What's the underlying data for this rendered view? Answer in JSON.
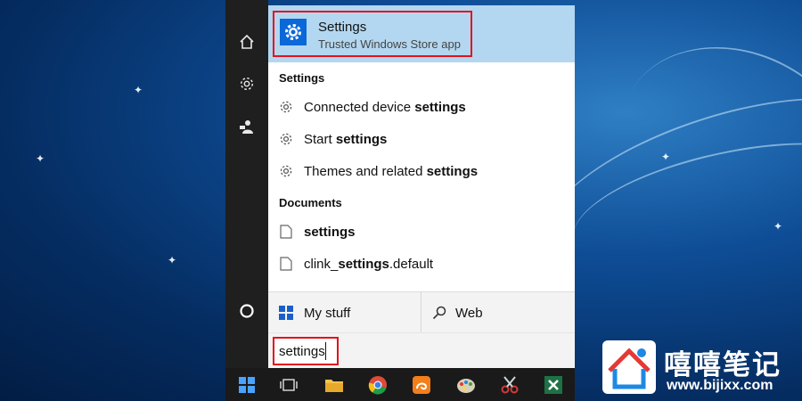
{
  "best_match": {
    "title": "Settings",
    "subtitle": "Trusted Windows Store app"
  },
  "sections": {
    "settings_header": "Settings",
    "documents_header": "Documents"
  },
  "settings_results": [
    {
      "prefix": "Connected device ",
      "match": "settings",
      "suffix": "",
      "icon": "gear-icon"
    },
    {
      "prefix": "Start ",
      "match": "settings",
      "suffix": "",
      "icon": "gear-icon"
    },
    {
      "prefix": "Themes and related ",
      "match": "settings",
      "suffix": "",
      "icon": "gear-icon"
    }
  ],
  "document_results": [
    {
      "prefix": "",
      "match": "settings",
      "suffix": "",
      "icon": "document-icon"
    },
    {
      "prefix": "clink_",
      "match": "settings",
      "suffix": ".default",
      "icon": "document-icon"
    }
  ],
  "bottom": {
    "my_stuff": "My stuff",
    "web": "Web"
  },
  "search": {
    "query": "settings"
  },
  "watermark": {
    "brand": "嘻嘻笔记",
    "url": "www.bijixx.com"
  },
  "colors": {
    "highlight_box": "#e4121b",
    "best_match_bg": "#b3d7f0",
    "settings_tile": "#0a68d8"
  }
}
